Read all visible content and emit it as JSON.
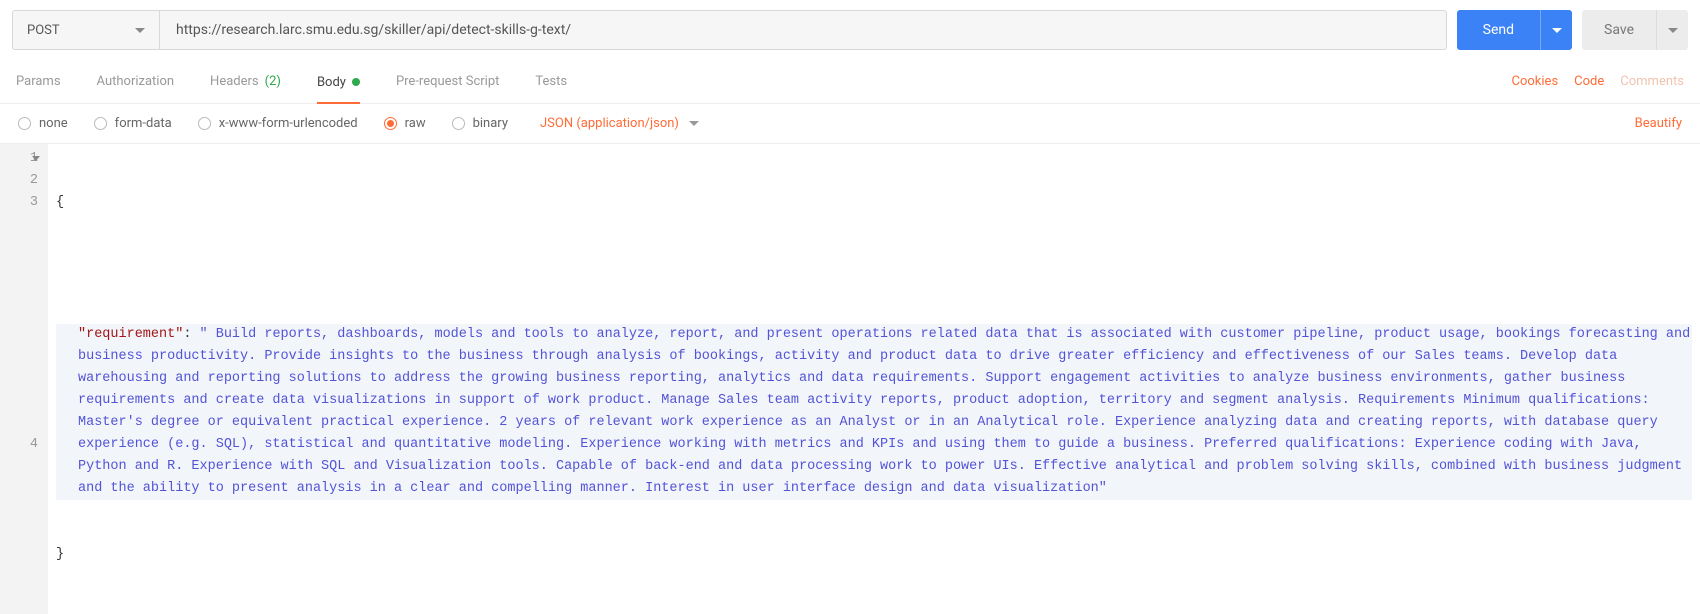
{
  "request": {
    "method": "POST",
    "url": "https://research.larc.smu.edu.sg/skiller/api/detect-skills-g-text/",
    "send_label": "Send",
    "save_label": "Save"
  },
  "tabs": {
    "params": "Params",
    "authorization": "Authorization",
    "headers": "Headers",
    "headers_count": "(2)",
    "body": "Body",
    "prerequest": "Pre-request Script",
    "tests": "Tests",
    "cookies": "Cookies",
    "code": "Code",
    "comments": "Comments"
  },
  "body_types": {
    "none": "none",
    "form_data": "form-data",
    "urlencoded": "x-www-form-urlencoded",
    "raw": "raw",
    "binary": "binary",
    "content_type": "JSON (application/json)",
    "beautify": "Beautify"
  },
  "editor": {
    "line1": "{",
    "line2": "",
    "line3_key": "\"requirement\"",
    "line3_colon": ": ",
    "line3_value": "\" Build reports, dashboards, models and tools to analyze, report, and present operations related data that is associated with customer pipeline, product usage, bookings forecasting and business productivity. Provide insights to the business through analysis of bookings, activity and product data to drive greater efficiency and effectiveness of our Sales teams. Develop data warehousing and reporting solutions to address the growing business reporting, analytics and data requirements. Support engagement activities to analyze business environments, gather business requirements and create data visualizations in support of work product. Manage Sales team activity reports, product adoption, territory and segment analysis. Requirements Minimum qualifications: Master's degree or equivalent practical experience. 2 years of relevant work experience as an Analyst or in an Analytical role. Experience analyzing data and creating reports, with database query experience (e.g. SQL), statistical and quantitative modeling. Experience working with metrics and KPIs and using them to guide a business. Preferred qualifications: Experience coding with Java, Python and R. Experience with SQL and Visualization tools. Capable of back-end and data processing work to power UIs. Effective analytical and problem solving skills, combined with business judgment and the ability to present analysis in a clear and compelling manner. Interest in user interface design and data visualization\"",
    "line4": "}",
    "gutter": [
      "1",
      "2",
      "3",
      "4"
    ]
  }
}
